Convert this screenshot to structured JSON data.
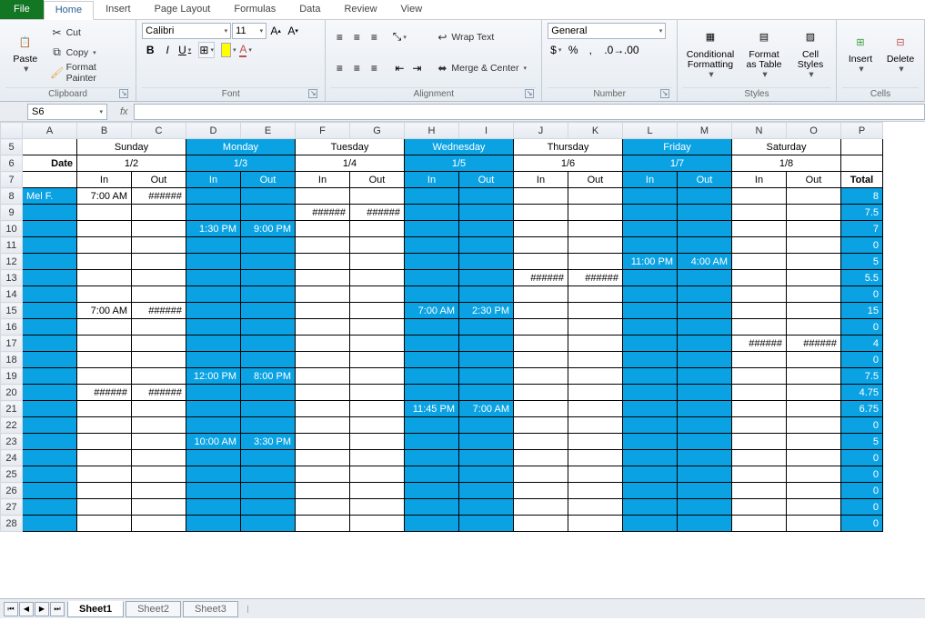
{
  "tabs": {
    "file": "File",
    "items": [
      "Home",
      "Insert",
      "Page Layout",
      "Formulas",
      "Data",
      "Review",
      "View"
    ],
    "active": "Home"
  },
  "ribbon": {
    "clipboard": {
      "label": "Clipboard",
      "paste": "Paste",
      "cut": "Cut",
      "copy": "Copy",
      "painter": "Format Painter"
    },
    "font": {
      "label": "Font",
      "name": "Calibri",
      "size": "11"
    },
    "alignment": {
      "label": "Alignment",
      "wrap": "Wrap Text",
      "merge": "Merge & Center"
    },
    "number": {
      "label": "Number",
      "format": "General"
    },
    "styles": {
      "label": "Styles",
      "cond": "Conditional\nFormatting",
      "table": "Format\nas Table",
      "cell": "Cell\nStyles"
    },
    "cells": {
      "label": "Cells",
      "insert": "Insert",
      "delete": "Delete"
    }
  },
  "fx": {
    "namebox": "S6",
    "fx_label": "fx"
  },
  "columns": [
    "A",
    "B",
    "C",
    "D",
    "E",
    "F",
    "G",
    "H",
    "I",
    "J",
    "K",
    "L",
    "M",
    "N",
    "O",
    "P"
  ],
  "row_start": 5,
  "row_end": 28,
  "days": [
    "Sunday",
    "Monday",
    "Tuesday",
    "Wednesday",
    "Thursday",
    "Friday",
    "Saturday"
  ],
  "blue_days": [
    false,
    true,
    false,
    true,
    false,
    true,
    false
  ],
  "date_label": "Date",
  "dates": [
    "1/2",
    "1/3",
    "1/4",
    "1/5",
    "1/6",
    "1/7",
    "1/8"
  ],
  "inout": {
    "in": "In",
    "out": "Out",
    "total": "Total"
  },
  "names_col": [
    "Mel F.",
    "",
    "",
    "",
    "",
    "",
    "",
    "",
    "",
    "",
    "",
    "",
    "",
    "",
    "",
    "",
    "",
    "",
    "",
    "",
    ""
  ],
  "cells": {
    "8": {
      "B": "7:00 AM",
      "C": "######",
      "P": "8"
    },
    "9": {
      "F": "######",
      "G": "######",
      "P": "7.5"
    },
    "10": {
      "D": "1:30 PM",
      "E": "9:00 PM",
      "P": "7"
    },
    "11": {
      "P": "0"
    },
    "12": {
      "L": "11:00 PM",
      "M": "4:00 AM",
      "P": "5"
    },
    "13": {
      "J": "######",
      "K": "######",
      "P": "5.5"
    },
    "14": {
      "P": "0"
    },
    "15": {
      "B": "7:00 AM",
      "C": "######",
      "H": "7:00 AM",
      "I": "2:30 PM",
      "P": "15"
    },
    "16": {
      "P": "0"
    },
    "17": {
      "N": "######",
      "O": "######",
      "P": "4"
    },
    "18": {
      "P": "0"
    },
    "19": {
      "D": "12:00 PM",
      "E": "8:00 PM",
      "P": "7.5"
    },
    "20": {
      "B": "######",
      "C": "######",
      "P": "4.75"
    },
    "21": {
      "H": "11:45 PM",
      "I": "7:00 AM",
      "P": "6.75"
    },
    "22": {
      "P": "0"
    },
    "23": {
      "D": "10:00 AM",
      "E": "3:30 PM",
      "P": "5"
    },
    "24": {
      "P": "0"
    },
    "25": {
      "P": "0"
    },
    "26": {
      "P": "0"
    },
    "27": {
      "P": "0"
    },
    "28": {
      "P": "0"
    }
  },
  "sheettabs": {
    "sheets": [
      "Sheet1",
      "Sheet2",
      "Sheet3"
    ],
    "active": "Sheet1"
  }
}
